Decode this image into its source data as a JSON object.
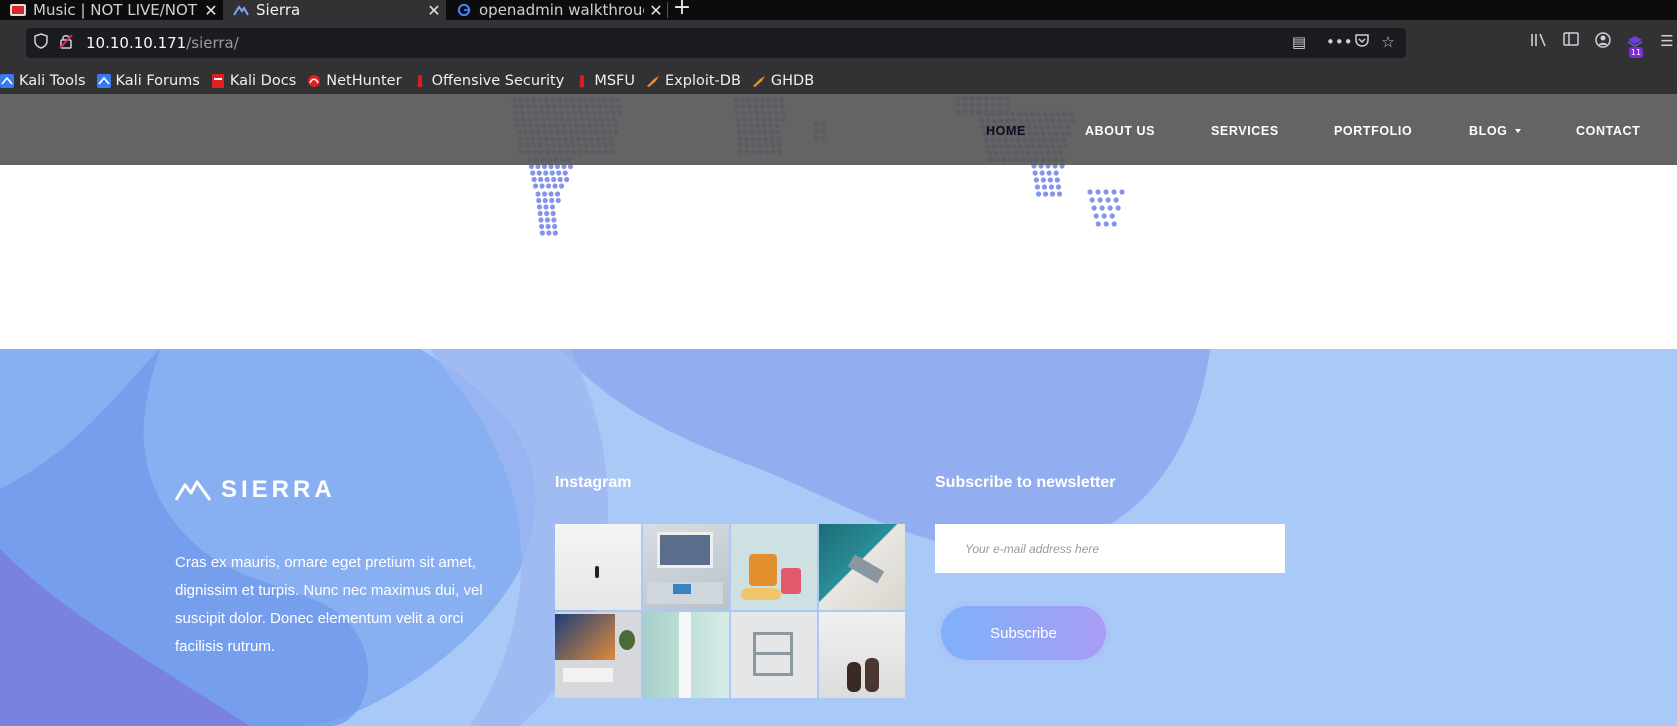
{
  "browser": {
    "tabs": [
      {
        "title": "Music | NOT LIVE/NOT F",
        "favicon": "youtube-red-icon"
      },
      {
        "title": "Sierra",
        "favicon": "sierra-logo-icon"
      },
      {
        "title": "openadmin walkthrough",
        "favicon": "google-icon"
      }
    ],
    "url_host": "10.10.10.171",
    "url_path": "/sierra/",
    "extension_badge": "11",
    "bookmarks": [
      {
        "label": "Kali Tools",
        "icon": "kali-dragon-icon"
      },
      {
        "label": "Kali Forums",
        "icon": "kali-dragon-icon"
      },
      {
        "label": "Kali Docs",
        "icon": "kali-docs-icon"
      },
      {
        "label": "NetHunter",
        "icon": "nethunter-icon"
      },
      {
        "label": "Offensive Security",
        "icon": "offsec-icon"
      },
      {
        "label": "MSFU",
        "icon": "offsec-icon"
      },
      {
        "label": "Exploit-DB",
        "icon": "exploitdb-icon"
      },
      {
        "label": "GHDB",
        "icon": "exploitdb-icon"
      }
    ]
  },
  "site": {
    "nav": {
      "home": "HOME",
      "about": "ABOUT US",
      "services": "SERVICES",
      "portfolio": "PORTFOLIO",
      "blog": "BLOG",
      "contact": "CONTACT"
    },
    "footer": {
      "brand": "SIERRA",
      "description": "Cras ex mauris, ornare eget pretium sit amet, dignissim et turpis. Nunc nec maximus dui, vel suscipit dolor. Donec elementum velit a orci facilisis rutrum.",
      "instagram_heading": "Instagram",
      "newsletter_heading": "Subscribe to newsletter",
      "email_placeholder": "Your e-mail address here",
      "subscribe_label": "Subscribe"
    }
  },
  "colors": {
    "accent_blue": "#7fb1f8",
    "accent_purple": "#a89cf6",
    "footer_bg": "#a9c9f6"
  }
}
